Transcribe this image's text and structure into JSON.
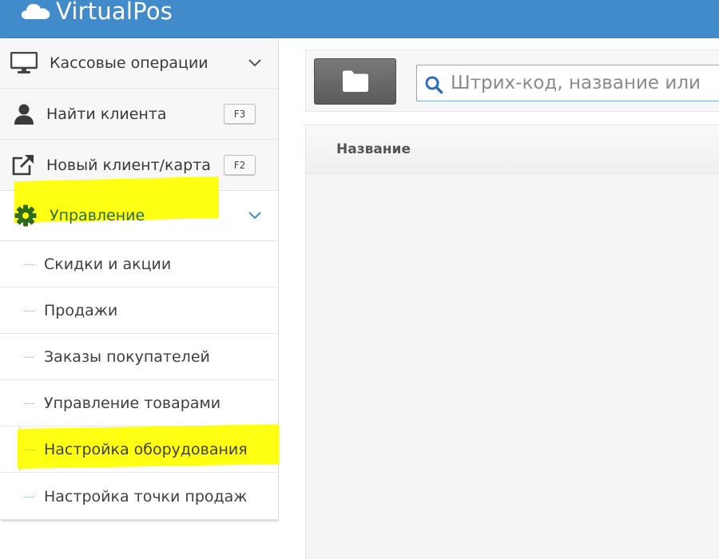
{
  "app": {
    "title": "VirtualPos",
    "logo_icon": "cloud-icon",
    "accent": "#428bca"
  },
  "sidebar": {
    "items": [
      {
        "label": "Кассовые операции",
        "icon": "monitor-icon",
        "expanded": false
      },
      {
        "label": "Найти клиента",
        "icon": "user-icon",
        "shortcut": "F3"
      },
      {
        "label": "Новый клиент/карта",
        "icon": "external-link-icon",
        "shortcut": "F2"
      },
      {
        "label": "Управление",
        "icon": "gear-icon",
        "expanded": true
      }
    ],
    "submenu": [
      {
        "label": "Скидки и акции"
      },
      {
        "label": "Продажи"
      },
      {
        "label": "Заказы покупателей"
      },
      {
        "label": "Управление товарами"
      },
      {
        "label": "Настройка оборудования"
      },
      {
        "label": "Настройка точки продаж"
      }
    ]
  },
  "toolbar": {
    "folder_icon": "folder-icon",
    "search": {
      "placeholder": "Штрих-код, название или",
      "icon": "search-icon"
    }
  },
  "table": {
    "columns": [
      "Название"
    ]
  },
  "highlight": {
    "color": "#ffff00"
  }
}
